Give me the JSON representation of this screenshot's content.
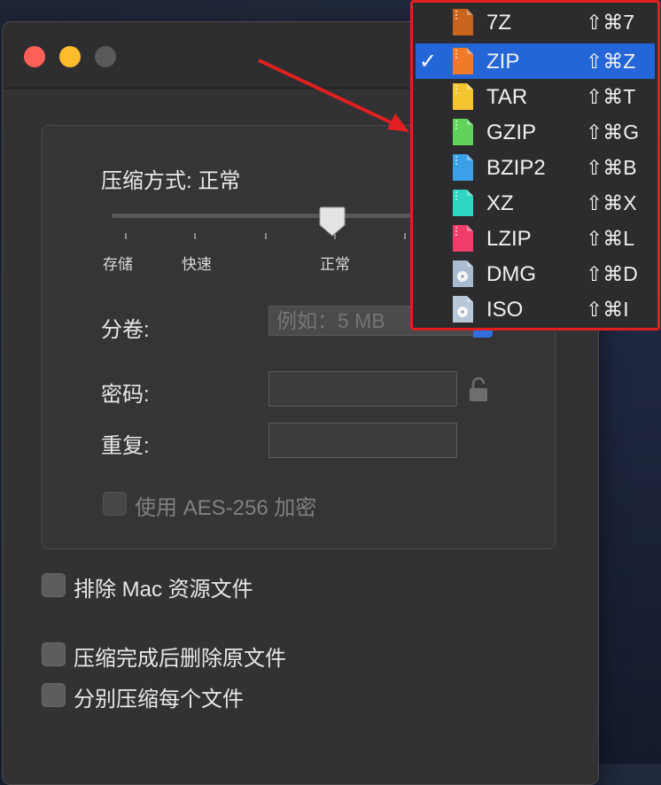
{
  "options": {
    "method_label": "压缩方式: 正常",
    "slider_ticks": [
      "存储",
      "快速",
      "正常"
    ],
    "slider_selected": "正常",
    "volume_label": "分卷:",
    "volume_placeholder": "例如：5 MB",
    "password_label": "密码:",
    "repeat_label": "重复:",
    "aes_label": "使用 AES-256 加密",
    "exclude_mac_label": "排除 Mac 资源文件",
    "delete_after_label": "压缩完成后删除原文件",
    "separate_label": "分别压缩每个文件"
  },
  "format_menu": {
    "selected": "ZIP",
    "items": [
      {
        "name": "7Z",
        "shortcut": "⇧⌘7",
        "color": "#c8641e"
      },
      {
        "name": "ZIP",
        "shortcut": "⇧⌘Z",
        "color": "#f07a2a"
      },
      {
        "name": "TAR",
        "shortcut": "⇧⌘T",
        "color": "#f5c431"
      },
      {
        "name": "GZIP",
        "shortcut": "⇧⌘G",
        "color": "#5fd35a"
      },
      {
        "name": "BZIP2",
        "shortcut": "⇧⌘B",
        "color": "#3aa0e8"
      },
      {
        "name": "XZ",
        "shortcut": "⇧⌘X",
        "color": "#2fd6c2"
      },
      {
        "name": "LZIP",
        "shortcut": "⇧⌘L",
        "color": "#f03c6a"
      },
      {
        "name": "DMG",
        "shortcut": "⇧⌘D",
        "color": "#a9bcd0"
      },
      {
        "name": "ISO",
        "shortcut": "⇧⌘I",
        "color": "#b8c8d8"
      }
    ]
  },
  "colors": {
    "highlight_box": "#e02020",
    "selection": "#2466d8"
  }
}
